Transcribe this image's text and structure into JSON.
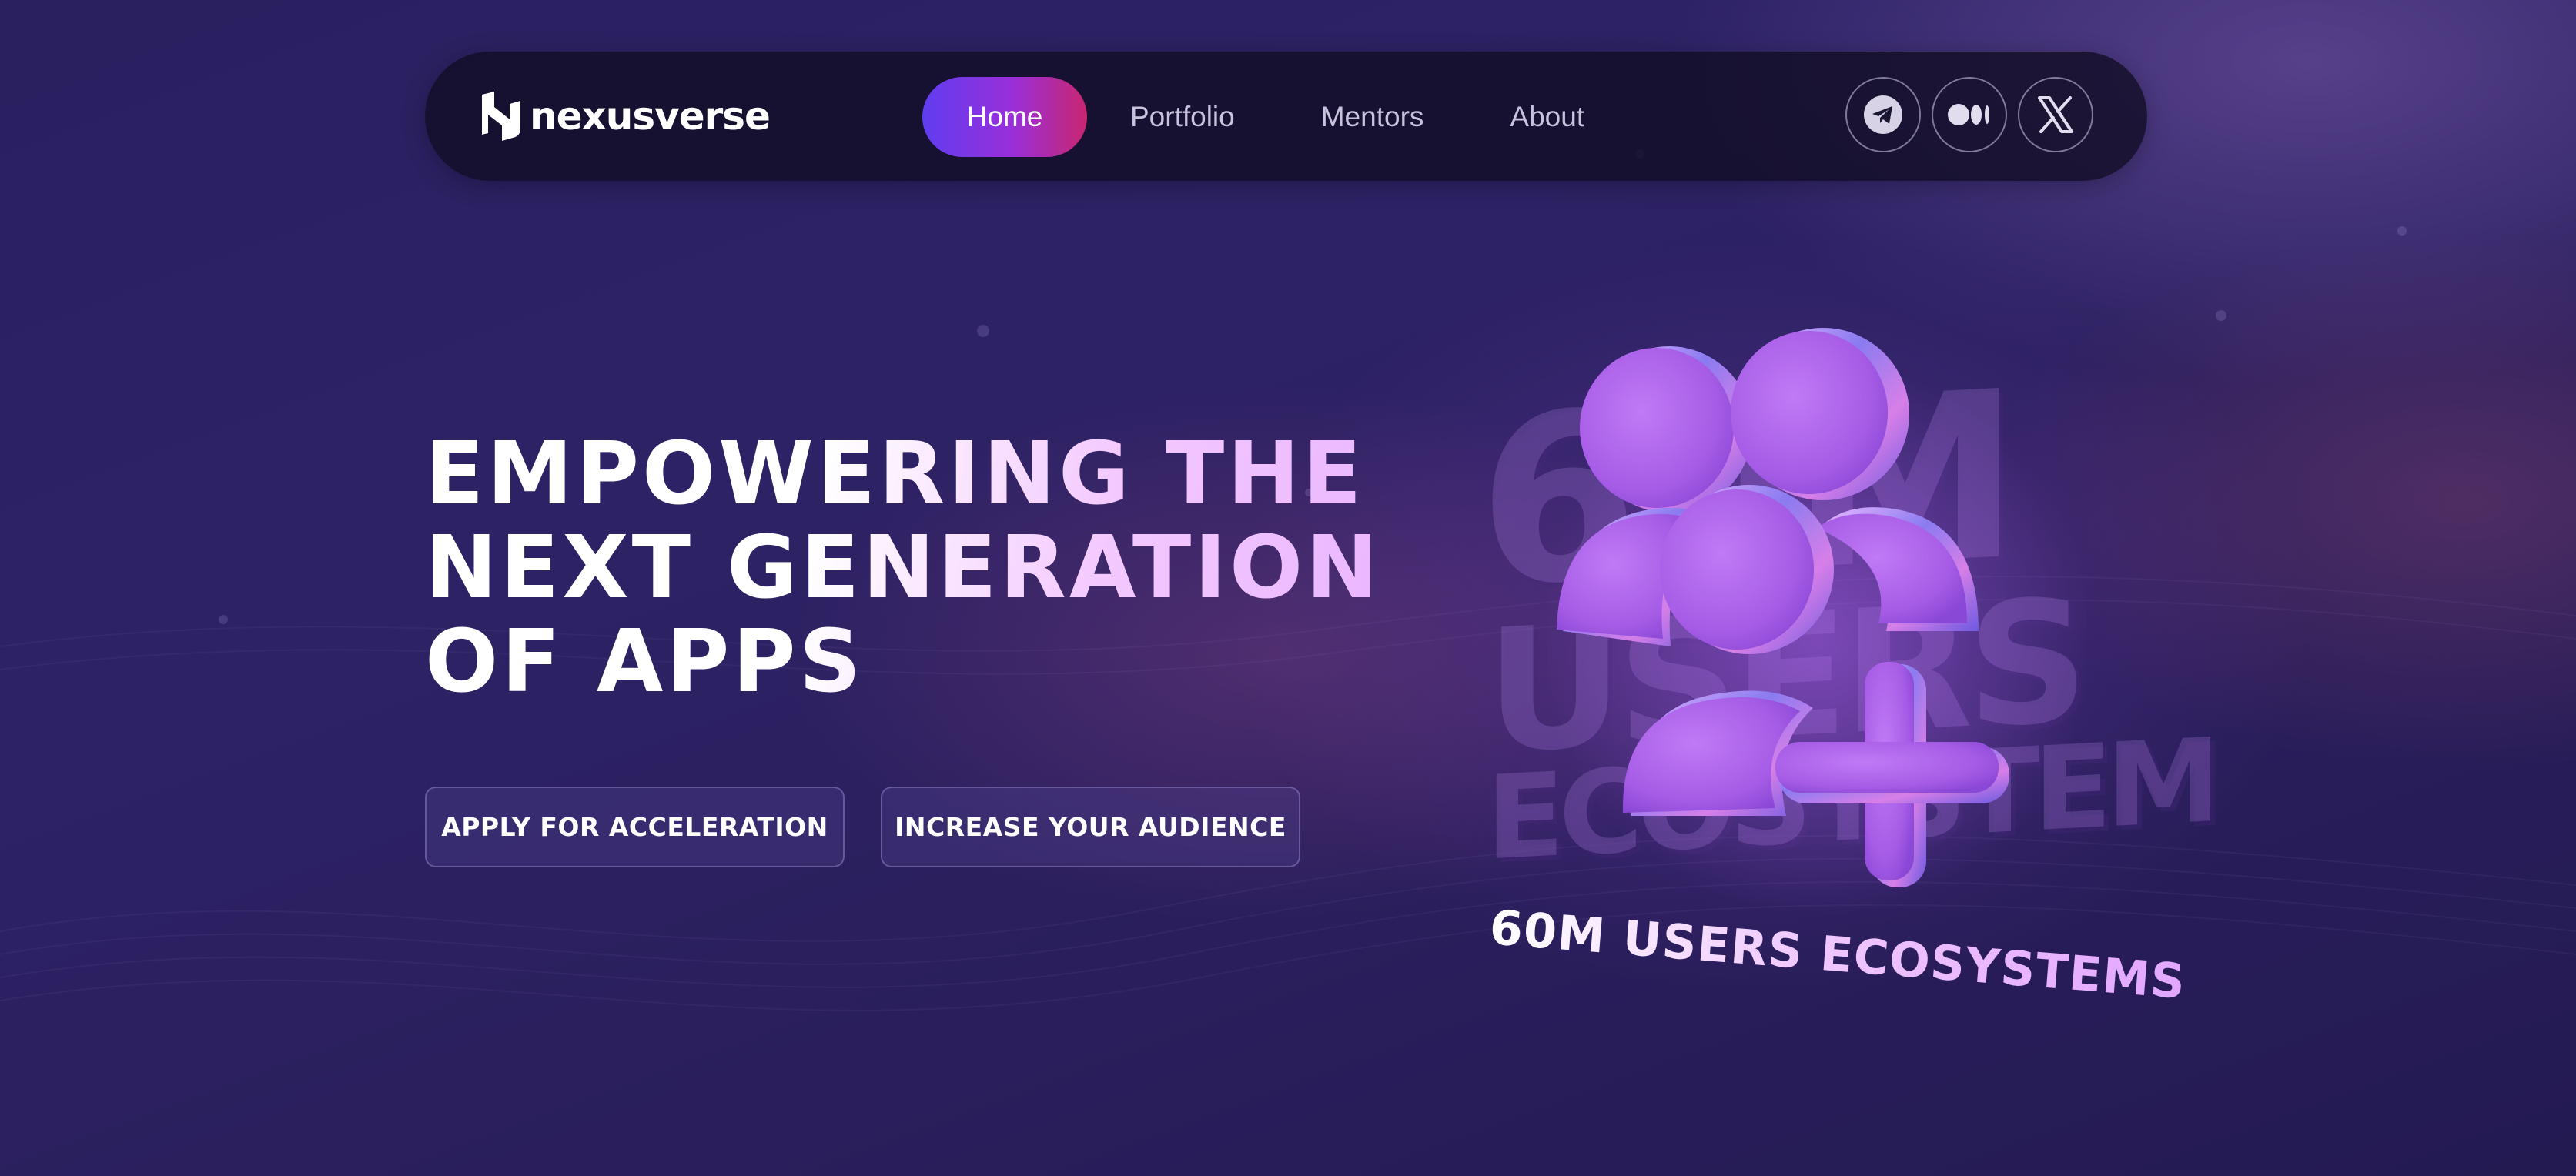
{
  "nav": {
    "logo_text": "nexusverse",
    "items": [
      {
        "label": "Home",
        "active": true
      },
      {
        "label": "Portfolio",
        "active": false
      },
      {
        "label": "Mentors",
        "active": false
      },
      {
        "label": "About",
        "active": false
      }
    ],
    "socials": [
      {
        "icon": "telegram-icon"
      },
      {
        "icon": "medium-icon"
      },
      {
        "icon": "x-icon"
      }
    ]
  },
  "hero": {
    "title_lines": [
      "EMPOWERING THE",
      "NEXT GENERATION",
      "OF APPS"
    ],
    "buttons": [
      {
        "label": "APPLY FOR ACCELERATION"
      },
      {
        "label": "INCREASE YOUR AUDIENCE"
      }
    ]
  },
  "illustration": {
    "background_text": [
      "60M",
      "USERS",
      "ECOSYSTEM"
    ],
    "caption": "60M USERS ECOSYSTEMS",
    "icon": "users-plus-icon"
  },
  "colors": {
    "background": "#2b1f5e",
    "nav_bg": "#120e26",
    "accent_start": "#5f3df0",
    "accent_mid": "#9a2fd9",
    "accent_end": "#c8266f",
    "title_pink": "#f3c8ff",
    "graphic_purple": "#b26cf0"
  }
}
